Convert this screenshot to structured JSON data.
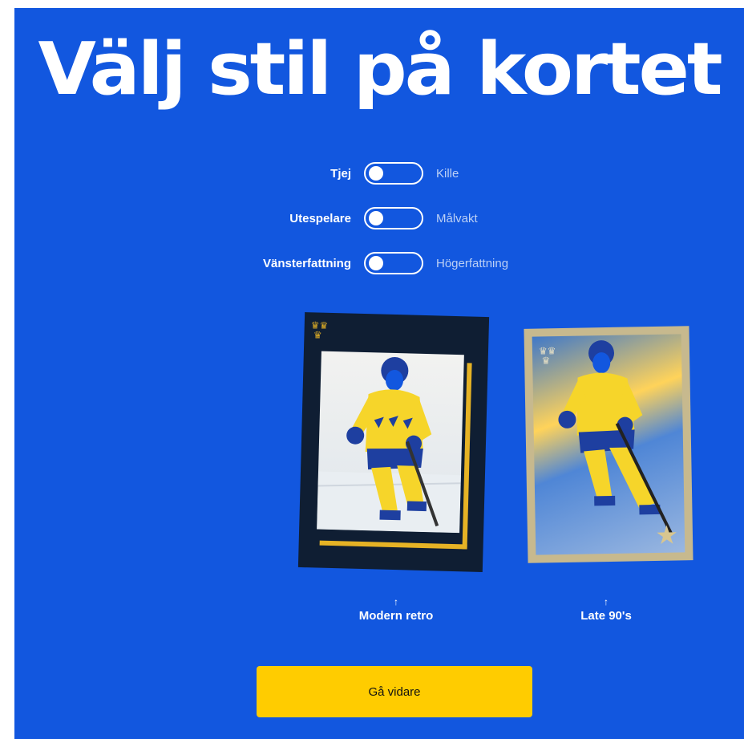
{
  "page": {
    "title": "Välj stil på kortet"
  },
  "toggles": [
    {
      "left_label": "Tjej",
      "right_label": "Kille",
      "state": "left"
    },
    {
      "left_label": "Utespelare",
      "right_label": "Målvakt",
      "state": "left"
    },
    {
      "left_label": "Vänsterfattning",
      "right_label": "Högerfattning",
      "state": "left"
    }
  ],
  "styles": [
    {
      "label": "Modern retro",
      "arrow": "↑"
    },
    {
      "label": "Late 90's",
      "arrow": "↑"
    }
  ],
  "actions": {
    "continue_label": "Gå vidare"
  },
  "colors": {
    "background": "#1257df",
    "accent": "#ffcc00",
    "jersey_yellow": "#f6d52a",
    "jersey_blue": "#1e3fa0",
    "card_dark": "#0f1e33",
    "card_gold": "#c7b98e"
  },
  "icons": {
    "crown": "three-crowns-icon",
    "star": "star-icon"
  }
}
